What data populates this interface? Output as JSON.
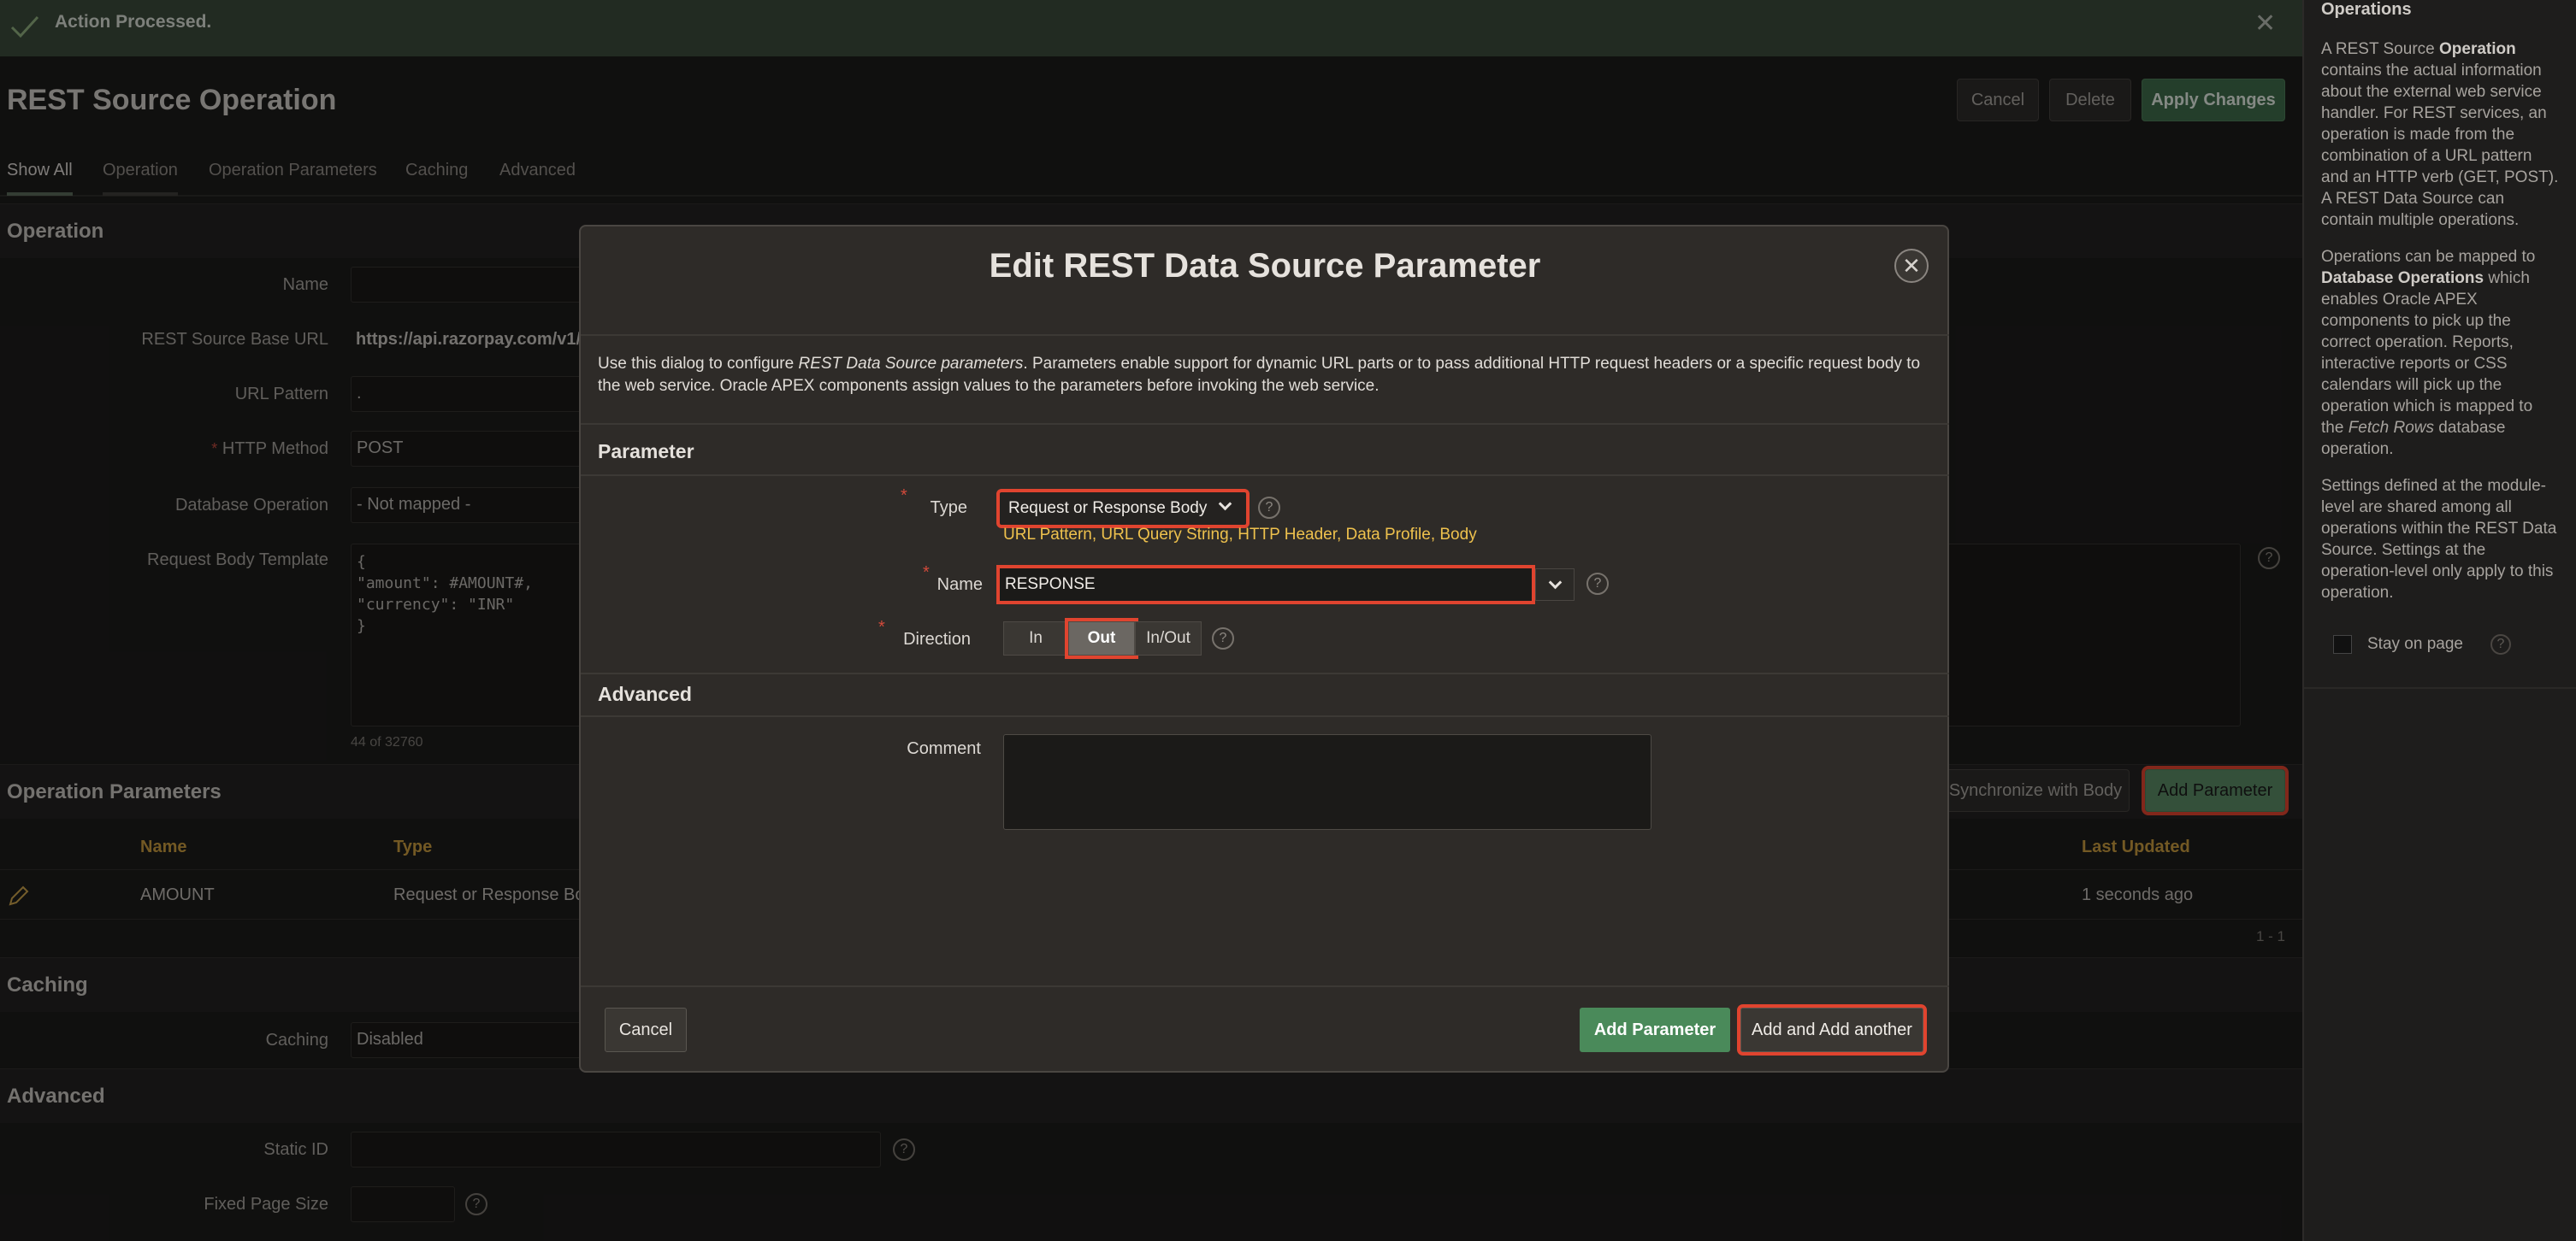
{
  "notification": {
    "message": "Action Processed."
  },
  "page": {
    "title": "REST Source Operation",
    "buttons": {
      "cancel": "Cancel",
      "delete": "Delete",
      "apply": "Apply Changes"
    },
    "tabs": [
      "Show All",
      "Operation",
      "Operation Parameters",
      "Caching",
      "Advanced"
    ]
  },
  "operation_section": {
    "heading": "Operation",
    "name_label": "Name",
    "base_url_label": "REST Source Base URL",
    "base_url_value": "https://api.razorpay.com/v1/",
    "url_pattern_label": "URL Pattern",
    "url_pattern_value": ".",
    "method_label": "HTTP Method",
    "method_value": "POST",
    "db_op_label": "Database Operation",
    "db_op_value": "- Not mapped -",
    "body_label": "Request Body Template",
    "body_lines": [
      "{",
      "\"amount\": #AMOUNT#,",
      "\"currency\": \"INR\"",
      "}"
    ],
    "body_counter": "44 of 32760"
  },
  "params_section": {
    "heading": "Operation Parameters",
    "sync_button": "Synchronize with Body",
    "add_button": "Add Parameter",
    "columns": {
      "name": "Name",
      "type": "Type",
      "updated": "Last Updated"
    },
    "row": {
      "name": "AMOUNT",
      "type": "Request or Response Body",
      "updated": "1 seconds ago"
    },
    "pagination": "1 - 1"
  },
  "caching_section": {
    "heading": "Caching",
    "label": "Caching",
    "value": "Disabled"
  },
  "advanced_section": {
    "heading": "Advanced",
    "static_id_label": "Static ID",
    "page_size_label": "Fixed Page Size"
  },
  "sidebar": {
    "heading": "Operations",
    "p1_a": "A REST Source ",
    "p1_b": "Operation",
    "p1_c": " contains the actual information about the external web service handler. For REST services, an operation is made from the combination of a URL pattern and an HTTP verb (GET, POST). A REST Data Source can contain multiple operations.",
    "p2_a": "Operations can be mapped to ",
    "p2_b": "Database Operations",
    "p2_c": " which enables Oracle APEX components to pick up the correct operation. Reports, interactive reports or CSS calendars will pick up the operation which is mapped to the ",
    "p2_d": "Fetch Rows",
    "p2_e": " database operation.",
    "p3": "Settings defined at the module-level are shared among all operations within the REST Data Source. Settings at the operation-level only apply to this operation.",
    "stay_label": "Stay on page"
  },
  "dialog": {
    "title": "Edit REST Data Source Parameter",
    "desc_a": "Use this dialog to configure ",
    "desc_b": "REST Data Source parameters",
    "desc_c": ". Parameters enable support for dynamic URL parts or to pass additional HTTP request headers or a specific request body to the web service. Oracle APEX components assign values to the parameters before invoking the web service.",
    "param_heading": "Parameter",
    "type_label": "Type",
    "type_value": "Request or Response Body",
    "type_options_hint": "URL Pattern, URL Query String, HTTP Header, Data Profile, Body",
    "name_label": "Name",
    "name_value": "RESPONSE",
    "direction_label": "Direction",
    "direction_options": [
      "In",
      "Out",
      "In/Out"
    ],
    "direction_selected": "Out",
    "advanced_heading": "Advanced",
    "comment_label": "Comment",
    "cancel": "Cancel",
    "add": "Add Parameter",
    "add_another": "Add and Add another"
  },
  "colors": {
    "accent_green": "#4a8a5a",
    "highlight": "#e0442f",
    "hint_yellow": "#eec14d"
  }
}
